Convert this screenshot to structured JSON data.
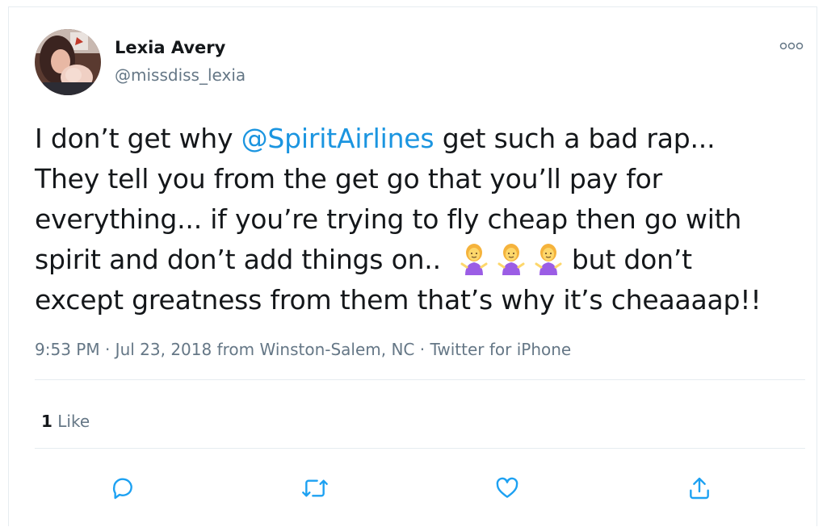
{
  "user": {
    "name": "Lexia Avery",
    "handle": "@missdiss_lexia"
  },
  "tweet": {
    "line1": {
      "before": "I don’t get why ",
      "mention": "@SpiritAirlines",
      "after": " get such a bad rap..."
    },
    "line2": "They tell you from the get go that you’ll pay for",
    "line3": "everything... if you’re trying to fly cheap then go with",
    "line4": {
      "before": "spirit and don’t add things on..",
      "after": "but don’t"
    },
    "line5": "except greatness from them that’s why it’s cheaaaap!!",
    "emojis": [
      "person-shrugging-emoji",
      "person-shrugging-emoji",
      "person-shrugging-emoji"
    ]
  },
  "meta": {
    "time": "9:53 PM",
    "sep1": " · ",
    "date": "Jul 23, 2018",
    "from": " from ",
    "location": "Winston-Salem, NC",
    "sep2": " · ",
    "source": "Twitter for iPhone"
  },
  "stats": {
    "likes_count": "1",
    "likes_label": " Like"
  },
  "icons": {
    "more": "more-options-icon",
    "reply": "reply-icon",
    "retweet": "retweet-icon",
    "like": "heart-icon",
    "share": "share-icon"
  },
  "colors": {
    "link": "#1b95e0",
    "secondary_text": "#657786",
    "icon": "#1da1f2",
    "divider": "#e6ecf0"
  }
}
